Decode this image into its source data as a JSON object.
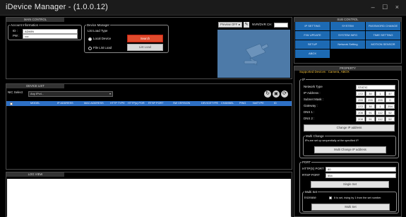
{
  "app": {
    "title": "iDevice Manager - (1.0.0.12)",
    "window_buttons": "– ☐ ×"
  },
  "main_control": {
    "header": "MAIN CONTROL",
    "account": {
      "legend": "Account Information",
      "id_label": "ID :",
      "id_value": "ADMIN",
      "pw_label": "PW :",
      "pw_value": "••••"
    },
    "device_manager": {
      "legend": "Device Manager",
      "list_type_label": "List Load Type",
      "local_device": "Local Device",
      "file_list_load": "File List Load",
      "search_label": "Search",
      "list_load_label": "List Load"
    },
    "preview": {
      "button_label": "Preview OFF ●",
      "icon_button": "✎",
      "nvr_label": "NVR/DVR CH:",
      "camera_icon": "security-camera-icon"
    }
  },
  "device_list": {
    "header": "DEVICE LIST",
    "nic_label": "NIC Select",
    "nic_value": "Any IPv4 -",
    "columns": [
      "MODEL",
      "IP ADDRESS",
      "MAC ADDRESS",
      "HTTP TYPE",
      "HTTP(s) POR",
      "RTSP PORT",
      "SW VERSION",
      "DEVICETYPE",
      "CHANNEL",
      "PING",
      "NetTYPE",
      "ID"
    ],
    "icons": [
      "refresh-icon",
      "save-icon",
      "reload-icon"
    ]
  },
  "log_view": {
    "header": "LOG VIEW"
  },
  "sub_control": {
    "header": "SUB CONTROL",
    "buttons": [
      "IP SETTING",
      "SYSTEM",
      "PASSWORD CHANGE",
      "F/W UPDATE",
      "SYSTEM INFO",
      "TIME SETTING",
      "SETUP",
      "Network Setting",
      "MOTION SENSOR",
      "ABOX"
    ]
  },
  "property": {
    "header": "PROPERTY",
    "supported": "Supported Devices : Camera, ABOX",
    "ip_legend": "IP",
    "network_type_label": "Network Type",
    "network_type_value": "STATIC",
    "ip_label": "IP Address :",
    "ip_value": [
      "172",
      "30",
      "1",
      "47"
    ],
    "subnet_label": "Subnet Mask :",
    "subnet_value": [
      "255",
      "255",
      "255",
      "0"
    ],
    "gateway_label": "Gateway :",
    "gateway_value": [
      "172",
      "30",
      "1",
      "254"
    ],
    "dns1_label": "DNS 1 :",
    "dns1_value": [
      "208",
      "91",
      "112",
      "52"
    ],
    "dns2_label": "DNS 2 :",
    "dns2_value": [
      "208",
      "91",
      "112",
      "52"
    ],
    "change_ip_button": "Change IP address",
    "multi_change_legend": "Multi Change",
    "multi_change_note": "IPs are set up sequentially at the specified IP.",
    "multi_change_button": "Multi Change IP address",
    "port_legend": "PORT",
    "http_port_label": "HTTP(S) PORT",
    "http_port_value": "80",
    "rtsp_port_label": "RTSP PORT",
    "rtsp_port_value": "554",
    "single_set_button": "Single Set",
    "multi_set_legend": "Multi Set",
    "increase_label": "Increase",
    "increase_note": "It is set, rising by 1 from the set number.",
    "multi_set_button": "Multi Set"
  },
  "colors": {
    "accent": "#1d6ab3",
    "search": "#e04a2c",
    "grid_header": "#2d6fc4",
    "preview": "#4d7aa8"
  }
}
